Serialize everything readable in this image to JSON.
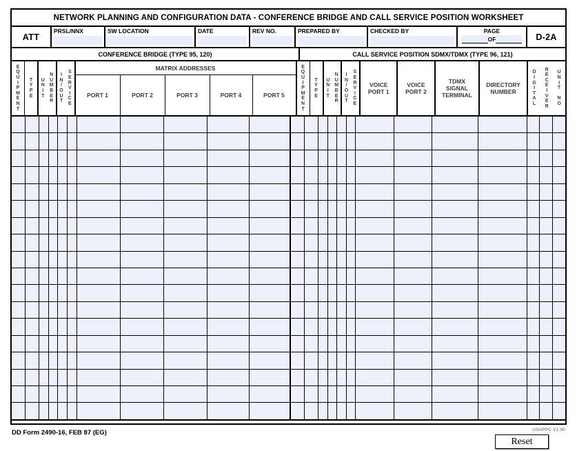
{
  "form": {
    "title": "NETWORK PLANNING AND CONFIGURATION DATA - CONFERENCE BRIDGE AND CALL SERVICE POSITION WORKSHEET",
    "form_id": "DD Form 2490-16, FEB 87 (EG)",
    "vendor_tag": "USAPPC V1.00",
    "sheet_code": "D-2A",
    "reset_label": "Reset"
  },
  "info_row": {
    "att_label": "ATT",
    "fields": [
      {
        "label": "PRSL/NNX",
        "value": ""
      },
      {
        "label": "SW LOCATION",
        "value": ""
      },
      {
        "label": "DATE",
        "value": ""
      },
      {
        "label": "REV NO.",
        "value": ""
      },
      {
        "label": "PREPARED BY",
        "value": ""
      },
      {
        "label": "CHECKED BY",
        "value": ""
      }
    ],
    "page": {
      "page_label": "PAGE",
      "of_label": "OF",
      "page_value": "",
      "total_value": ""
    }
  },
  "sections": {
    "left_title": "CONFERENCE BRIDGE (TYPE 95, 120)",
    "right_title": "CALL SERVICE POSITION SDMX/TDMX (TYPE 96, 121)"
  },
  "headers": {
    "left": {
      "equipment": "EQUIPMENT",
      "type": "TYPE",
      "unit": "UNIT",
      "number": "NUMBER",
      "in_out": "IN / OUT",
      "service": "SERVICE",
      "matrix_title": "MATRIX ADDRESSES",
      "ports": [
        "PORT 1",
        "PORT 2",
        "PORT 3",
        "PORT 4",
        "PORT 5"
      ]
    },
    "right": {
      "equipment": "EQUIPMENT",
      "type": "TYPE",
      "unit": "UNIT",
      "number": "NUMBER",
      "in_out": "IN / OUT",
      "service": "SERVICE",
      "voice_port_1": "VOICE\nPORT 1",
      "voice_port_2": "VOICE\nPORT 2",
      "tdmx": "TDMX\nSIGNAL\nTERMINAL",
      "directory": "DIRECTORY\nNUMBER",
      "digital": "DIGITAL",
      "receiver": "RECEIVER",
      "unit_no": "UNIT NO"
    }
  },
  "grid": {
    "row_count": 18,
    "left_columns": [
      "equipment",
      "type",
      "unit-number",
      "in-out",
      "service",
      "matrix-port-1",
      "matrix-port-2",
      "matrix-port-3",
      "matrix-port-4",
      "matrix-port-5"
    ],
    "right_columns": [
      "equipment",
      "type",
      "unit-number",
      "in-out",
      "service",
      "voice-port-1",
      "voice-port-2",
      "tdmx-signal-terminal",
      "directory-number",
      "digital",
      "receiver",
      "unit-no"
    ],
    "rows": [
      {
        "left": [
          "",
          "",
          "",
          "",
          "",
          "",
          "",
          "",
          "",
          ""
        ],
        "right": [
          "",
          "",
          "",
          "",
          "",
          "",
          "",
          "",
          "",
          "",
          "",
          ""
        ]
      },
      {
        "left": [
          "",
          "",
          "",
          "",
          "",
          "",
          "",
          "",
          "",
          ""
        ],
        "right": [
          "",
          "",
          "",
          "",
          "",
          "",
          "",
          "",
          "",
          "",
          "",
          ""
        ]
      },
      {
        "left": [
          "",
          "",
          "",
          "",
          "",
          "",
          "",
          "",
          "",
          ""
        ],
        "right": [
          "",
          "",
          "",
          "",
          "",
          "",
          "",
          "",
          "",
          "",
          "",
          ""
        ]
      },
      {
        "left": [
          "",
          "",
          "",
          "",
          "",
          "",
          "",
          "",
          "",
          ""
        ],
        "right": [
          "",
          "",
          "",
          "",
          "",
          "",
          "",
          "",
          "",
          "",
          "",
          ""
        ]
      },
      {
        "left": [
          "",
          "",
          "",
          "",
          "",
          "",
          "",
          "",
          "",
          ""
        ],
        "right": [
          "",
          "",
          "",
          "",
          "",
          "",
          "",
          "",
          "",
          "",
          "",
          ""
        ]
      },
      {
        "left": [
          "",
          "",
          "",
          "",
          "",
          "",
          "",
          "",
          "",
          ""
        ],
        "right": [
          "",
          "",
          "",
          "",
          "",
          "",
          "",
          "",
          "",
          "",
          "",
          ""
        ]
      },
      {
        "left": [
          "",
          "",
          "",
          "",
          "",
          "",
          "",
          "",
          "",
          ""
        ],
        "right": [
          "",
          "",
          "",
          "",
          "",
          "",
          "",
          "",
          "",
          "",
          "",
          ""
        ]
      },
      {
        "left": [
          "",
          "",
          "",
          "",
          "",
          "",
          "",
          "",
          "",
          ""
        ],
        "right": [
          "",
          "",
          "",
          "",
          "",
          "",
          "",
          "",
          "",
          "",
          "",
          ""
        ]
      },
      {
        "left": [
          "",
          "",
          "",
          "",
          "",
          "",
          "",
          "",
          "",
          ""
        ],
        "right": [
          "",
          "",
          "",
          "",
          "",
          "",
          "",
          "",
          "",
          "",
          "",
          ""
        ]
      },
      {
        "left": [
          "",
          "",
          "",
          "",
          "",
          "",
          "",
          "",
          "",
          ""
        ],
        "right": [
          "",
          "",
          "",
          "",
          "",
          "",
          "",
          "",
          "",
          "",
          "",
          ""
        ]
      },
      {
        "left": [
          "",
          "",
          "",
          "",
          "",
          "",
          "",
          "",
          "",
          ""
        ],
        "right": [
          "",
          "",
          "",
          "",
          "",
          "",
          "",
          "",
          "",
          "",
          "",
          ""
        ]
      },
      {
        "left": [
          "",
          "",
          "",
          "",
          "",
          "",
          "",
          "",
          "",
          ""
        ],
        "right": [
          "",
          "",
          "",
          "",
          "",
          "",
          "",
          "",
          "",
          "",
          "",
          ""
        ]
      },
      {
        "left": [
          "",
          "",
          "",
          "",
          "",
          "",
          "",
          "",
          "",
          ""
        ],
        "right": [
          "",
          "",
          "",
          "",
          "",
          "",
          "",
          "",
          "",
          "",
          "",
          ""
        ]
      },
      {
        "left": [
          "",
          "",
          "",
          "",
          "",
          "",
          "",
          "",
          "",
          ""
        ],
        "right": [
          "",
          "",
          "",
          "",
          "",
          "",
          "",
          "",
          "",
          "",
          "",
          ""
        ]
      },
      {
        "left": [
          "",
          "",
          "",
          "",
          "",
          "",
          "",
          "",
          "",
          ""
        ],
        "right": [
          "",
          "",
          "",
          "",
          "",
          "",
          "",
          "",
          "",
          "",
          "",
          ""
        ]
      },
      {
        "left": [
          "",
          "",
          "",
          "",
          "",
          "",
          "",
          "",
          "",
          ""
        ],
        "right": [
          "",
          "",
          "",
          "",
          "",
          "",
          "",
          "",
          "",
          "",
          "",
          ""
        ]
      },
      {
        "left": [
          "",
          "",
          "",
          "",
          "",
          "",
          "",
          "",
          "",
          ""
        ],
        "right": [
          "",
          "",
          "",
          "",
          "",
          "",
          "",
          "",
          "",
          "",
          "",
          ""
        ]
      },
      {
        "left": [
          "",
          "",
          "",
          "",
          "",
          "",
          "",
          "",
          "",
          ""
        ],
        "right": [
          "",
          "",
          "",
          "",
          "",
          "",
          "",
          "",
          "",
          "",
          "",
          ""
        ]
      }
    ]
  },
  "colors": {
    "field_fill": "#eef1fc",
    "header_text": "#3a3a46",
    "rule": "#000000"
  }
}
